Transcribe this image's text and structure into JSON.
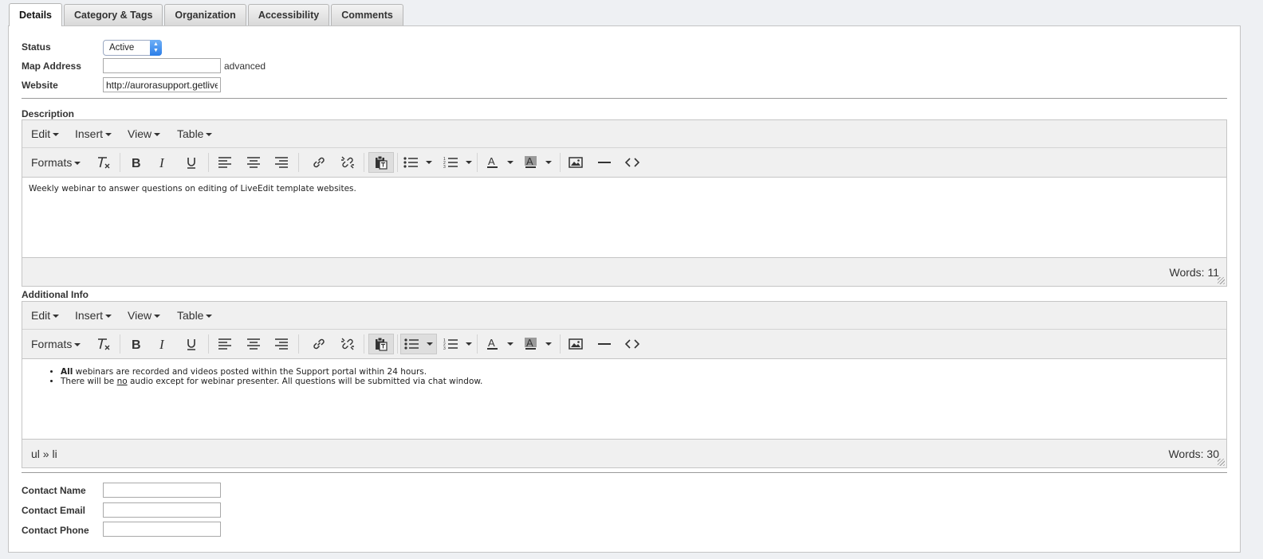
{
  "tabs": [
    "Details",
    "Category & Tags",
    "Organization",
    "Accessibility",
    "Comments"
  ],
  "form": {
    "status_label": "Status",
    "status_value": "Active",
    "map_label": "Map Address",
    "map_value": "",
    "advanced_link": "advanced",
    "website_label": "Website",
    "website_value": "http://aurorasupport.getlive"
  },
  "menus": [
    "Edit",
    "Insert",
    "View",
    "Table"
  ],
  "formats_label": "Formats",
  "description": {
    "label": "Description",
    "text": "Weekly webinar to answer questions on editing of LiveEdit template websites.",
    "path": "",
    "word_count": "Words: 11"
  },
  "additional": {
    "label": "Additional Info",
    "item1_bold": "All",
    "item1_rest": " webinars are recorded and videos posted within the Support portal within 24 hours.",
    "item2_pre": "There will be ",
    "item2_u": "no",
    "item2_post": " audio except for webinar presenter.  All questions will be submitted via chat window.",
    "path": "ul » li",
    "word_count": "Words: 30"
  },
  "contact": {
    "name_label": "Contact Name",
    "email_label": "Contact Email",
    "phone_label": "Contact Phone",
    "name_value": "",
    "email_value": "",
    "phone_value": ""
  }
}
